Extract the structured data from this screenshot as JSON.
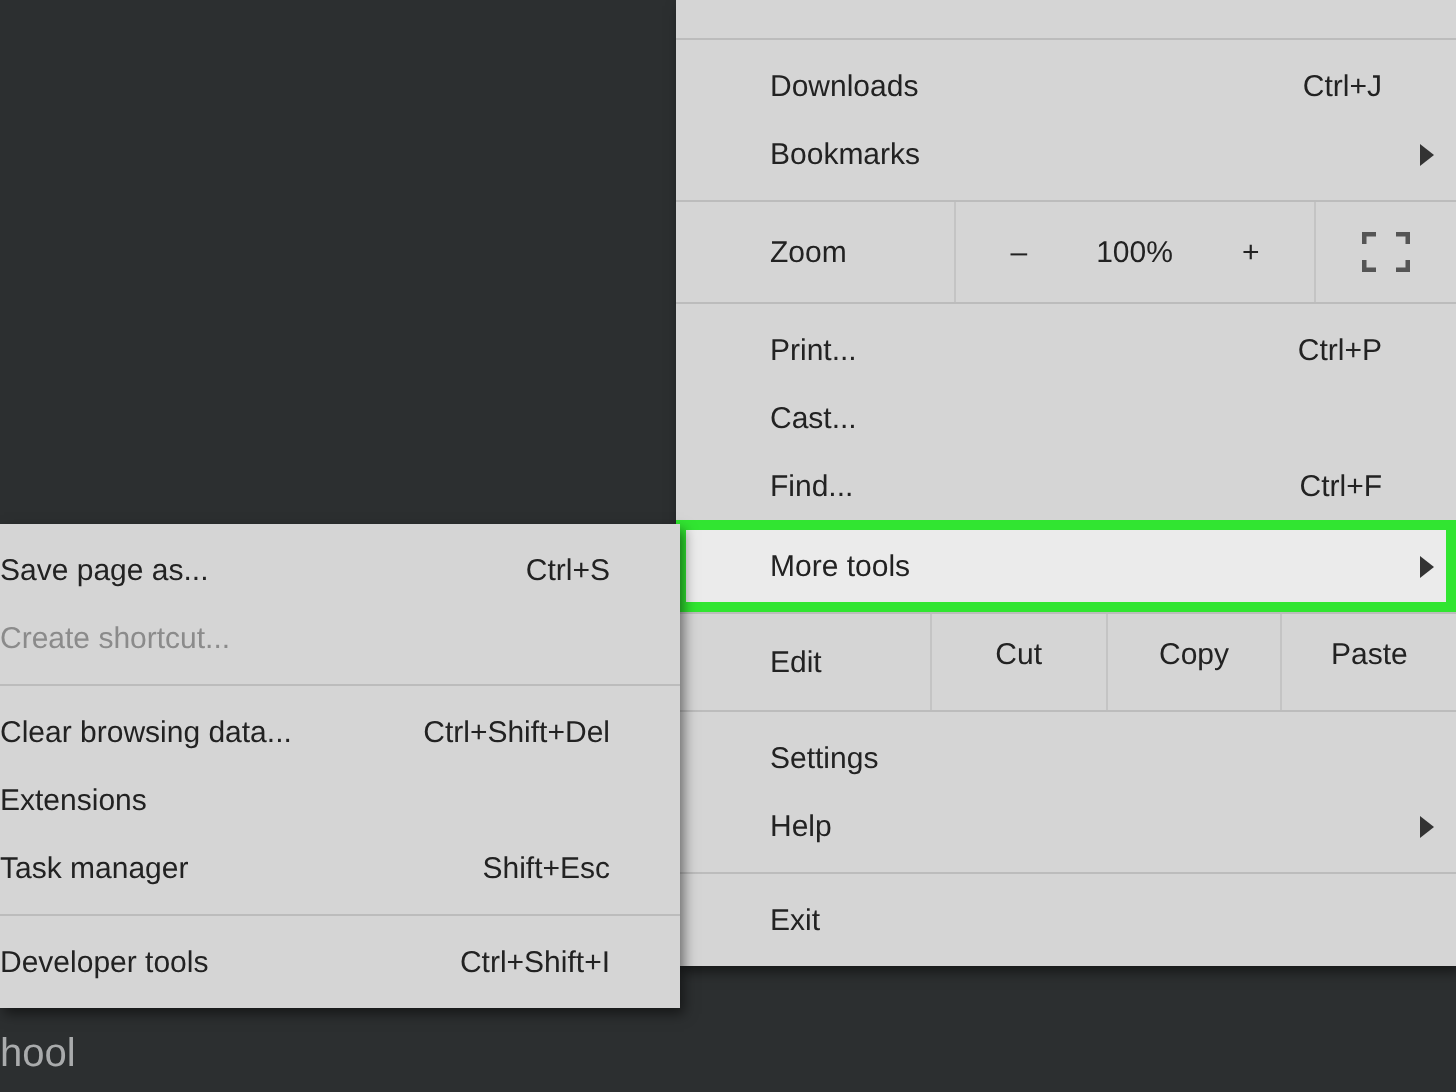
{
  "main_menu": {
    "sections": [
      {
        "rows": [
          {
            "kind": "item",
            "label": "Downloads",
            "shortcut": "Ctrl+J",
            "submenu": false,
            "selected": false
          },
          {
            "kind": "item",
            "label": "Bookmarks",
            "submenu": true,
            "selected": false
          }
        ]
      },
      {
        "rows": [
          {
            "kind": "zoom",
            "label": "Zoom",
            "minus": "–",
            "value": "100%",
            "plus": "+"
          }
        ]
      },
      {
        "rows": [
          {
            "kind": "item",
            "label": "Print...",
            "shortcut": "Ctrl+P",
            "submenu": false,
            "selected": false
          },
          {
            "kind": "item",
            "label": "Cast...",
            "submenu": false,
            "selected": false
          },
          {
            "kind": "item",
            "label": "Find...",
            "shortcut": "Ctrl+F",
            "submenu": false,
            "selected": false
          },
          {
            "kind": "item",
            "label": "More tools",
            "submenu": true,
            "selected": true
          }
        ]
      },
      {
        "rows": [
          {
            "kind": "edit",
            "label": "Edit",
            "buttons": [
              "Cut",
              "Copy",
              "Paste"
            ]
          }
        ]
      },
      {
        "rows": [
          {
            "kind": "item",
            "label": "Settings",
            "submenu": false,
            "selected": false
          },
          {
            "kind": "item",
            "label": "Help",
            "submenu": true,
            "selected": false
          }
        ]
      },
      {
        "rows": [
          {
            "kind": "item",
            "label": "Exit",
            "submenu": false,
            "selected": false
          }
        ]
      }
    ]
  },
  "more_tools_submenu": {
    "sections": [
      {
        "rows": [
          {
            "label": "Save page as...",
            "shortcut": "Ctrl+S",
            "disabled": false
          },
          {
            "label": "Create shortcut...",
            "disabled": true
          }
        ]
      },
      {
        "rows": [
          {
            "label": "Clear browsing data...",
            "shortcut": "Ctrl+Shift+Del",
            "disabled": false
          },
          {
            "label": "Extensions",
            "disabled": false
          },
          {
            "label": "Task manager",
            "shortcut": "Shift+Esc",
            "disabled": false
          }
        ]
      },
      {
        "rows": [
          {
            "label": "Developer tools",
            "shortcut": "Ctrl+Shift+I",
            "disabled": false
          }
        ]
      }
    ]
  },
  "background_text": "hool"
}
